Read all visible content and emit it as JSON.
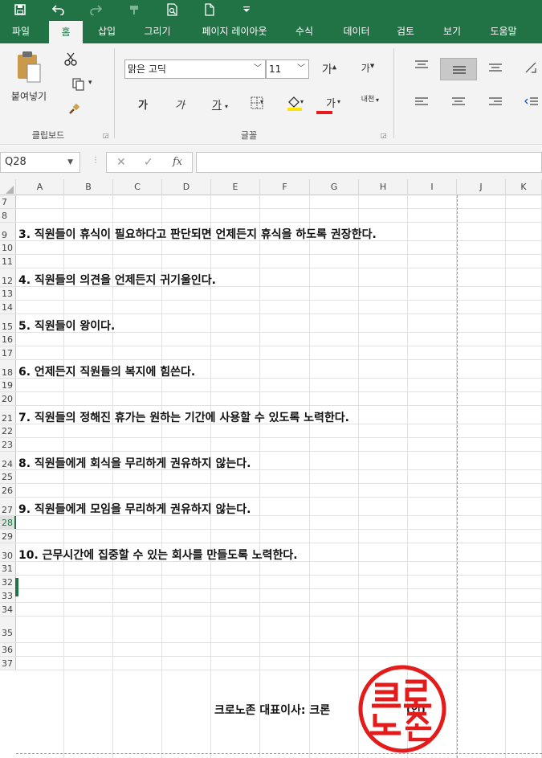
{
  "quick_access": {
    "save_icon": "save-icon",
    "undo_icon": "undo-icon",
    "redo_icon": "redo-icon",
    "format_icon": "format-painter-icon",
    "preview_icon": "print-preview-icon",
    "new_icon": "new-file-icon",
    "customize_icon": "customize-qat-icon"
  },
  "tabs": [
    "파일",
    "홈",
    "삽입",
    "그리기",
    "페이지 레이아웃",
    "수식",
    "데이터",
    "검토",
    "보기",
    "도움말"
  ],
  "active_tab": "홈",
  "ribbon": {
    "clipboard": {
      "paste_label": "붙여넣기",
      "group_label": "클립보드"
    },
    "font": {
      "font_name": "맑은 고딕",
      "font_size": "11",
      "grow_label": "가",
      "shrink_label": "가",
      "bold_label": "가",
      "italic_label": "가",
      "underline_label": "가",
      "font_color_label": "가",
      "phonetic_label": "내천",
      "group_label": "글꼴"
    }
  },
  "formula_bar": {
    "name_box": "Q28",
    "cancel": "✕",
    "enter": "✓",
    "fx": "fx",
    "formula": ""
  },
  "columns": [
    "A",
    "B",
    "C",
    "D",
    "E",
    "F",
    "G",
    "H",
    "I",
    "J",
    "K"
  ],
  "rows": [
    {
      "num": "7",
      "text": ""
    },
    {
      "num": "8",
      "text": ""
    },
    {
      "num": "9",
      "text": "3. 직원들이 휴식이 필요하다고 판단되면 언제든지 휴식을 하도록 권장한다."
    },
    {
      "num": "10",
      "text": ""
    },
    {
      "num": "11",
      "text": ""
    },
    {
      "num": "12",
      "text": "4. 직원들의 의견을 언제든지 귀기울인다."
    },
    {
      "num": "13",
      "text": ""
    },
    {
      "num": "14",
      "text": ""
    },
    {
      "num": "15",
      "text": "5. 직원들이 왕이다."
    },
    {
      "num": "16",
      "text": ""
    },
    {
      "num": "17",
      "text": ""
    },
    {
      "num": "18",
      "text": "6. 언제든지 직원들의 복지에 힘쓴다."
    },
    {
      "num": "19",
      "text": ""
    },
    {
      "num": "20",
      "text": ""
    },
    {
      "num": "21",
      "text": "7. 직원들의 정해진 휴가는 원하는 기간에 사용할 수 있도록 노력한다."
    },
    {
      "num": "22",
      "text": ""
    },
    {
      "num": "23",
      "text": ""
    },
    {
      "num": "24",
      "text": "8. 직원들에게 회식을 무리하게 권유하지 않는다."
    },
    {
      "num": "25",
      "text": ""
    },
    {
      "num": "26",
      "text": ""
    },
    {
      "num": "27",
      "text": "9. 직원들에게 모임을 무리하게 권유하지 않는다."
    },
    {
      "num": "28",
      "text": ""
    },
    {
      "num": "29",
      "text": ""
    },
    {
      "num": "30",
      "text": "10. 근무시간에 집중할 수 있는 회사를 만들도록 노력한다."
    },
    {
      "num": "31",
      "text": ""
    },
    {
      "num": "32",
      "text": ""
    },
    {
      "num": "33",
      "text": ""
    },
    {
      "num": "34",
      "text": ""
    },
    {
      "num": "35",
      "text": ""
    },
    {
      "num": "36",
      "text": ""
    },
    {
      "num": "37",
      "text": ""
    }
  ],
  "signature": {
    "text": "크로노존 대표이사: 크론",
    "seal_mark": "(인)"
  },
  "seal": {
    "lettering": "크로노존",
    "color": "#e31b1b"
  },
  "colors": {
    "accent": "#217346",
    "seal": "#e31b1b"
  }
}
